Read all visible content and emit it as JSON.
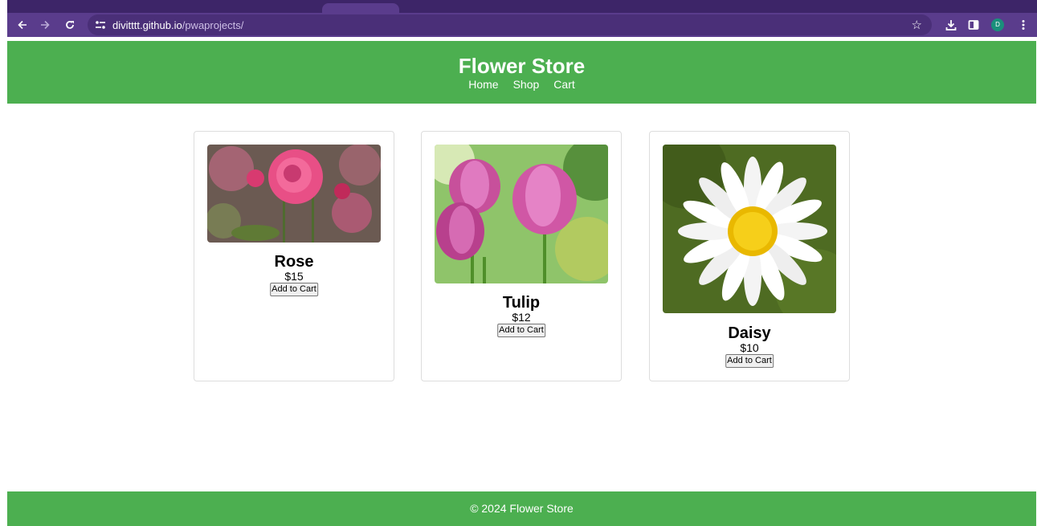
{
  "browser": {
    "url_host": "divitttt.github.io",
    "url_path": "/pwaprojects/",
    "profile_initial": "D",
    "icons": [
      "back-arrow-icon",
      "forward-arrow-icon",
      "reload-icon",
      "site-info-icon",
      "star-icon",
      "download-icon",
      "side-panel-icon",
      "kebab-menu-icon"
    ]
  },
  "header": {
    "title": "Flower Store",
    "nav": [
      "Home",
      "Shop",
      "Cart"
    ]
  },
  "products": [
    {
      "name": "Rose",
      "price": "$15",
      "button": "Add to Cart"
    },
    {
      "name": "Tulip",
      "price": "$12",
      "button": "Add to Cart"
    },
    {
      "name": "Daisy",
      "price": "$10",
      "button": "Add to Cart"
    }
  ],
  "footer": {
    "text": "© 2024 Flower Store"
  },
  "colors": {
    "brand_green": "#4caf50",
    "browser_purple": "#5a3c8c"
  }
}
